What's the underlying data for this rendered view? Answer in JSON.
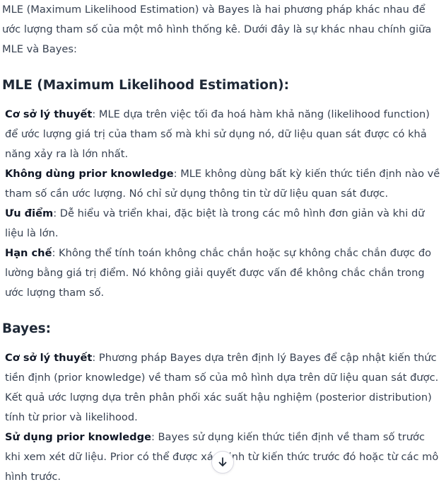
{
  "intro": "MLE (Maximum Likelihood Estimation) và Bayes là hai phương pháp khác nhau để ước lượng tham số của một mô hình thống kê. Dưới đây là sự khác nhau chính giữa MLE và Bayes:",
  "mle": {
    "heading": "MLE (Maximum Likelihood Estimation):",
    "items": [
      {
        "term": "Cơ sở lý thuyết",
        "text": ": MLE dựa trên việc tối đa hoá hàm khả năng (likelihood function) để ước lượng giá trị của tham số mà khi sử dụng nó, dữ liệu quan sát được có khả năng xảy ra là lớn nhất."
      },
      {
        "term": "Không dùng prior knowledge",
        "text": ": MLE không dùng bất kỳ kiến thức tiền định nào về tham số cần ước lượng. Nó chỉ sử dụng thông tin từ dữ liệu quan sát được."
      },
      {
        "term": "Ưu điểm",
        "text": ": Dễ hiểu và triển khai, đặc biệt là trong các mô hình đơn giản và khi dữ liệu là lớn."
      },
      {
        "term": "Hạn chế",
        "text": ": Không thể tính toán không chắc chắn hoặc sự không chắc chắn được đo lường bằng giá trị điểm. Nó không giải quyết được vấn đề không chắc chắn trong ước lượng tham số."
      }
    ]
  },
  "bayes": {
    "heading": "Bayes:",
    "items": [
      {
        "term": "Cơ sở lý thuyết",
        "text": ": Phương pháp Bayes dựa trên định lý Bayes để cập nhật kiến thức tiền định (prior knowledge) về tham số của mô hình dựa trên dữ liệu quan sát được. Kết quả ước lượng dựa trên phân phối xác suất hậu nghiệm (posterior distribution) tính từ prior và likelihood."
      },
      {
        "term": "Sử dụng prior knowledge",
        "text": ": Bayes sử dụng kiến thức tiền định về tham số trước khi xem xét dữ liệu. Prior có thể được xác định từ kiến thức trước đó hoặc từ các mô hình trước."
      }
    ]
  },
  "scroll_button": {
    "icon": "arrow-down-icon"
  }
}
